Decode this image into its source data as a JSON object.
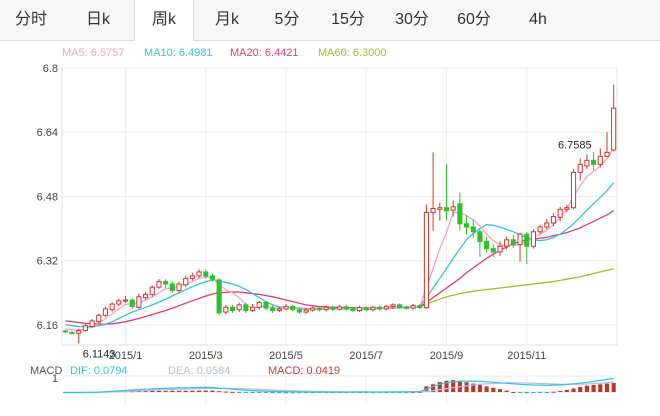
{
  "tabs": [
    {
      "label": "分时",
      "active": false
    },
    {
      "label": "日k",
      "active": false
    },
    {
      "label": "周k",
      "active": true
    },
    {
      "label": "月k",
      "active": false
    },
    {
      "label": "5分",
      "active": false
    },
    {
      "label": "15分",
      "active": false
    },
    {
      "label": "30分",
      "active": false
    },
    {
      "label": "60分",
      "active": false
    },
    {
      "label": "4h",
      "active": false
    }
  ],
  "legend": {
    "ma5": "MA5: 6.5757",
    "ma10": "MA10: 6.4981",
    "ma20": "MA20: 6.4421",
    "ma60": "MA60: 6.3000"
  },
  "macd_legend": {
    "title": "MACD",
    "dif": "DIF: 0.0794",
    "dea": "DEA: 0.0584",
    "macd": "MACD: 0.0419",
    "tick": "1"
  },
  "colors": {
    "up": "#d4352c",
    "down": "#2fbf2f",
    "ma5": "#f4a6c0",
    "ma10": "#35c2d6",
    "ma20": "#e03c6e",
    "ma60": "#9bbf2a",
    "dif": "#35c2d6",
    "dea": "#b9b9e8",
    "active_tab_text": "#333333"
  },
  "chart_data": {
    "type": "candlestick",
    "ylim": [
      6.11,
      6.8
    ],
    "yticks": [
      "6.8",
      "6.64",
      "6.48",
      "6.32",
      "6.16"
    ],
    "xticks": [
      "2015/1",
      "2015/3",
      "2015/5",
      "2015/7",
      "2015/9",
      "2015/11"
    ],
    "xtick_index": [
      9,
      21,
      33,
      45,
      57,
      69
    ],
    "max_label": "6.7585",
    "min_label": "6.1143",
    "max_index": 79,
    "min_index": 2,
    "candles": [
      [
        6.145,
        6.143,
        6.148,
        6.14
      ],
      [
        6.141,
        6.14,
        6.145,
        6.137
      ],
      [
        6.139,
        6.146,
        6.15,
        6.114
      ],
      [
        6.146,
        6.158,
        6.162,
        6.143
      ],
      [
        6.156,
        6.17,
        6.175,
        6.152
      ],
      [
        6.168,
        6.184,
        6.188,
        6.162
      ],
      [
        6.184,
        6.2,
        6.205,
        6.18
      ],
      [
        6.198,
        6.212,
        6.216,
        6.193
      ],
      [
        6.212,
        6.22,
        6.225,
        6.207
      ],
      [
        6.22,
        6.222,
        6.232,
        6.215
      ],
      [
        6.222,
        6.206,
        6.226,
        6.2
      ],
      [
        6.204,
        6.23,
        6.238,
        6.2
      ],
      [
        6.228,
        6.236,
        6.242,
        6.222
      ],
      [
        6.236,
        6.254,
        6.258,
        6.23
      ],
      [
        6.254,
        6.268,
        6.274,
        6.25
      ],
      [
        6.268,
        6.262,
        6.274,
        6.252
      ],
      [
        6.262,
        6.246,
        6.268,
        6.24
      ],
      [
        6.246,
        6.262,
        6.268,
        6.24
      ],
      [
        6.26,
        6.276,
        6.282,
        6.254
      ],
      [
        6.276,
        6.282,
        6.29,
        6.27
      ],
      [
        6.282,
        6.292,
        6.298,
        6.276
      ],
      [
        6.292,
        6.282,
        6.298,
        6.276
      ],
      [
        6.282,
        6.274,
        6.288,
        6.268
      ],
      [
        6.272,
        6.19,
        6.276,
        6.185
      ],
      [
        6.192,
        6.204,
        6.21,
        6.186
      ],
      [
        6.204,
        6.196,
        6.21,
        6.19
      ],
      [
        6.198,
        6.21,
        6.216,
        6.192
      ],
      [
        6.21,
        6.196,
        6.216,
        6.19
      ],
      [
        6.196,
        6.204,
        6.212,
        6.192
      ],
      [
        6.204,
        6.216,
        6.22,
        6.198
      ],
      [
        6.216,
        6.202,
        6.22,
        6.196
      ],
      [
        6.202,
        6.196,
        6.208,
        6.19
      ],
      [
        6.196,
        6.2,
        6.206,
        6.192
      ],
      [
        6.2,
        6.206,
        6.212,
        6.196
      ],
      [
        6.206,
        6.198,
        6.21,
        6.194
      ],
      [
        6.198,
        6.192,
        6.204,
        6.188
      ],
      [
        6.192,
        6.197,
        6.202,
        6.188
      ],
      [
        6.197,
        6.202,
        6.206,
        6.193
      ],
      [
        6.202,
        6.198,
        6.206,
        6.194
      ],
      [
        6.198,
        6.204,
        6.208,
        6.194
      ],
      [
        6.204,
        6.199,
        6.208,
        6.195
      ],
      [
        6.199,
        6.205,
        6.21,
        6.196
      ],
      [
        6.205,
        6.2,
        6.21,
        6.196
      ],
      [
        6.2,
        6.196,
        6.204,
        6.192
      ],
      [
        6.196,
        6.203,
        6.208,
        6.192
      ],
      [
        6.203,
        6.198,
        6.206,
        6.194
      ],
      [
        6.198,
        6.204,
        6.208,
        6.194
      ],
      [
        6.204,
        6.2,
        6.208,
        6.196
      ],
      [
        6.2,
        6.206,
        6.21,
        6.196
      ],
      [
        6.206,
        6.21,
        6.214,
        6.2
      ],
      [
        6.21,
        6.204,
        6.214,
        6.2
      ],
      [
        6.204,
        6.202,
        6.208,
        6.198
      ],
      [
        6.202,
        6.208,
        6.212,
        6.198
      ],
      [
        6.208,
        6.203,
        6.212,
        6.2
      ],
      [
        6.203,
        6.44,
        6.46,
        6.2
      ],
      [
        6.44,
        6.45,
        6.59,
        6.395
      ],
      [
        6.448,
        6.452,
        6.465,
        6.42
      ],
      [
        6.452,
        6.444,
        6.56,
        6.42
      ],
      [
        6.446,
        6.454,
        6.47,
        6.43
      ],
      [
        6.462,
        6.412,
        6.49,
        6.395
      ],
      [
        6.412,
        6.404,
        6.434,
        6.385
      ],
      [
        6.404,
        6.392,
        6.422,
        6.376
      ],
      [
        6.392,
        6.368,
        6.398,
        6.33
      ],
      [
        6.368,
        6.35,
        6.38,
        6.34
      ],
      [
        6.35,
        6.342,
        6.362,
        6.33
      ],
      [
        6.342,
        6.356,
        6.368,
        6.332
      ],
      [
        6.356,
        6.372,
        6.38,
        6.348
      ],
      [
        6.372,
        6.36,
        6.384,
        6.352
      ],
      [
        6.36,
        6.386,
        6.39,
        6.318
      ],
      [
        6.386,
        6.356,
        6.392,
        6.312
      ],
      [
        6.356,
        6.392,
        6.398,
        6.35
      ],
      [
        6.392,
        6.404,
        6.41,
        6.386
      ],
      [
        6.404,
        6.414,
        6.424,
        6.398
      ],
      [
        6.414,
        6.43,
        6.438,
        6.406
      ],
      [
        6.428,
        6.448,
        6.454,
        6.418
      ],
      [
        6.448,
        6.452,
        6.46,
        6.44
      ],
      [
        6.452,
        6.54,
        6.548,
        6.448
      ],
      [
        6.54,
        6.56,
        6.575,
        6.52
      ],
      [
        6.556,
        6.57,
        6.585,
        6.548
      ],
      [
        6.57,
        6.56,
        6.59,
        6.545
      ],
      [
        6.56,
        6.58,
        6.6,
        6.552
      ],
      [
        6.58,
        6.59,
        6.64,
        6.578
      ],
      [
        6.596,
        6.7,
        6.759,
        6.592
      ]
    ],
    "ma5": [
      6.15,
      6.148,
      6.147,
      6.15,
      6.155,
      6.163,
      6.176,
      6.188,
      6.2,
      6.211,
      6.213,
      6.215,
      6.222,
      6.23,
      6.24,
      6.25,
      6.253,
      6.256,
      6.262,
      6.268,
      6.276,
      6.28,
      6.278,
      6.26,
      6.248,
      6.24,
      6.228,
      6.21,
      6.202,
      6.205,
      6.206,
      6.204,
      6.202,
      6.203,
      6.202,
      6.2,
      6.199,
      6.199,
      6.199,
      6.2,
      6.2,
      6.201,
      6.202,
      6.201,
      6.201,
      6.2,
      6.2,
      6.201,
      6.202,
      6.204,
      6.205,
      6.205,
      6.205,
      6.206,
      6.252,
      6.3,
      6.35,
      6.39,
      6.44,
      6.44,
      6.432,
      6.422,
      6.406,
      6.386,
      6.37,
      6.36,
      6.356,
      6.358,
      6.36,
      6.368,
      6.378,
      6.386,
      6.396,
      6.41,
      6.428,
      6.448,
      6.48,
      6.506,
      6.53,
      6.542,
      6.556,
      6.574,
      6.6
    ],
    "ma10": [
      6.16,
      6.158,
      6.156,
      6.155,
      6.156,
      6.158,
      6.162,
      6.168,
      6.176,
      6.184,
      6.192,
      6.198,
      6.204,
      6.21,
      6.217,
      6.224,
      6.232,
      6.24,
      6.248,
      6.255,
      6.262,
      6.268,
      6.272,
      6.27,
      6.266,
      6.262,
      6.256,
      6.248,
      6.238,
      6.228,
      6.218,
      6.21,
      6.205,
      6.204,
      6.203,
      6.202,
      6.201,
      6.2,
      6.2,
      6.2,
      6.2,
      6.2,
      6.2,
      6.2,
      6.2,
      6.2,
      6.2,
      6.201,
      6.202,
      6.202,
      6.203,
      6.203,
      6.204,
      6.206,
      6.228,
      6.252,
      6.276,
      6.3,
      6.326,
      6.35,
      6.372,
      6.388,
      6.4,
      6.41,
      6.408,
      6.404,
      6.398,
      6.392,
      6.384,
      6.378,
      6.372,
      6.37,
      6.372,
      6.378,
      6.386,
      6.398,
      6.412,
      6.428,
      6.446,
      6.462,
      6.478,
      6.494,
      6.515
    ],
    "ma20": [
      6.17,
      6.168,
      6.166,
      6.164,
      6.163,
      6.162,
      6.162,
      6.163,
      6.165,
      6.168,
      6.172,
      6.176,
      6.181,
      6.186,
      6.191,
      6.196,
      6.202,
      6.208,
      6.214,
      6.22,
      6.226,
      6.232,
      6.237,
      6.24,
      6.241,
      6.242,
      6.242,
      6.24,
      6.238,
      6.236,
      6.233,
      6.23,
      6.226,
      6.222,
      6.218,
      6.214,
      6.21,
      6.208,
      6.206,
      6.205,
      6.204,
      6.204,
      6.203,
      6.203,
      6.202,
      6.202,
      6.202,
      6.202,
      6.202,
      6.202,
      6.203,
      6.203,
      6.204,
      6.205,
      6.216,
      6.228,
      6.24,
      6.252,
      6.264,
      6.276,
      6.29,
      6.302,
      6.314,
      6.326,
      6.336,
      6.346,
      6.354,
      6.362,
      6.368,
      6.372,
      6.374,
      6.376,
      6.378,
      6.382,
      6.386,
      6.39,
      6.396,
      6.402,
      6.41,
      6.418,
      6.426,
      6.434,
      6.445
    ],
    "ma60": [
      null,
      null,
      null,
      null,
      null,
      null,
      null,
      null,
      null,
      null,
      null,
      null,
      null,
      null,
      null,
      null,
      null,
      null,
      null,
      null,
      null,
      null,
      null,
      null,
      null,
      null,
      null,
      null,
      null,
      null,
      null,
      null,
      null,
      null,
      null,
      null,
      null,
      null,
      null,
      null,
      null,
      null,
      null,
      null,
      null,
      null,
      null,
      null,
      null,
      null,
      null,
      null,
      null,
      6.205,
      6.212,
      6.218,
      6.224,
      6.23,
      6.234,
      6.238,
      6.241,
      6.244,
      6.246,
      6.248,
      6.25,
      6.252,
      6.254,
      6.256,
      6.258,
      6.26,
      6.262,
      6.264,
      6.266,
      6.268,
      6.271,
      6.274,
      6.277,
      6.28,
      6.284,
      6.288,
      6.292,
      6.296,
      6.3
    ],
    "macd_hist": [
      -0.02,
      -0.02,
      -0.02,
      -0.01,
      -0.01,
      0.02,
      0.03,
      0.04,
      0.05,
      0.06,
      0.06,
      0.07,
      0.07,
      0.08,
      0.08,
      0.08,
      0.09,
      0.09,
      0.09,
      0.09,
      0.1,
      0.1,
      0.1,
      0.06,
      0.03,
      0.01,
      -0.01,
      -0.03,
      -0.05,
      -0.06,
      -0.07,
      -0.08,
      -0.08,
      -0.09,
      -0.09,
      -0.09,
      -0.08,
      -0.08,
      -0.07,
      -0.07,
      -0.06,
      -0.06,
      -0.05,
      -0.05,
      -0.04,
      -0.04,
      -0.03,
      -0.03,
      -0.02,
      -0.02,
      -0.01,
      -0.01,
      0.0,
      0.0,
      0.4,
      0.55,
      0.7,
      0.8,
      0.85,
      0.8,
      0.7,
      0.6,
      0.5,
      0.4,
      0.3,
      0.2,
      0.1,
      0.0,
      -0.05,
      -0.08,
      -0.06,
      -0.04,
      -0.02,
      0.02,
      0.08,
      0.15,
      0.25,
      0.35,
      0.45,
      0.5,
      0.55,
      0.6,
      0.65
    ],
    "dif": [
      -0.04,
      -0.04,
      -0.04,
      -0.03,
      -0.02,
      -0.01,
      0.02,
      0.05,
      0.08,
      0.11,
      0.14,
      0.17,
      0.2,
      0.22,
      0.24,
      0.26,
      0.28,
      0.29,
      0.3,
      0.31,
      0.32,
      0.33,
      0.33,
      0.28,
      0.24,
      0.2,
      0.16,
      0.13,
      0.1,
      0.08,
      0.06,
      0.04,
      0.03,
      0.02,
      0.01,
      0.0,
      0.0,
      -0.01,
      -0.01,
      -0.01,
      -0.01,
      -0.01,
      -0.01,
      -0.01,
      0.0,
      0.0,
      0.0,
      0.0,
      0.0,
      0.01,
      0.01,
      0.01,
      0.02,
      0.02,
      0.2,
      0.4,
      0.55,
      0.65,
      0.72,
      0.76,
      0.78,
      0.78,
      0.76,
      0.73,
      0.7,
      0.66,
      0.62,
      0.58,
      0.55,
      0.52,
      0.5,
      0.49,
      0.48,
      0.49,
      0.51,
      0.54,
      0.58,
      0.63,
      0.69,
      0.75,
      0.82,
      0.9,
      0.98
    ],
    "dea": [
      -0.03,
      -0.03,
      -0.03,
      -0.03,
      -0.03,
      -0.02,
      -0.01,
      0.0,
      0.02,
      0.04,
      0.06,
      0.08,
      0.1,
      0.12,
      0.14,
      0.16,
      0.18,
      0.19,
      0.21,
      0.22,
      0.24,
      0.25,
      0.26,
      0.26,
      0.26,
      0.25,
      0.24,
      0.22,
      0.2,
      0.18,
      0.16,
      0.14,
      0.12,
      0.1,
      0.09,
      0.07,
      0.06,
      0.05,
      0.04,
      0.03,
      0.02,
      0.02,
      0.01,
      0.01,
      0.01,
      0.0,
      0.0,
      0.0,
      0.0,
      0.0,
      0.0,
      0.0,
      0.01,
      0.01,
      0.05,
      0.1,
      0.17,
      0.24,
      0.31,
      0.38,
      0.44,
      0.5,
      0.54,
      0.58,
      0.61,
      0.63,
      0.65,
      0.65,
      0.65,
      0.64,
      0.63,
      0.61,
      0.59,
      0.57,
      0.56,
      0.55,
      0.55,
      0.56,
      0.57,
      0.6,
      0.63,
      0.67,
      0.72
    ]
  }
}
